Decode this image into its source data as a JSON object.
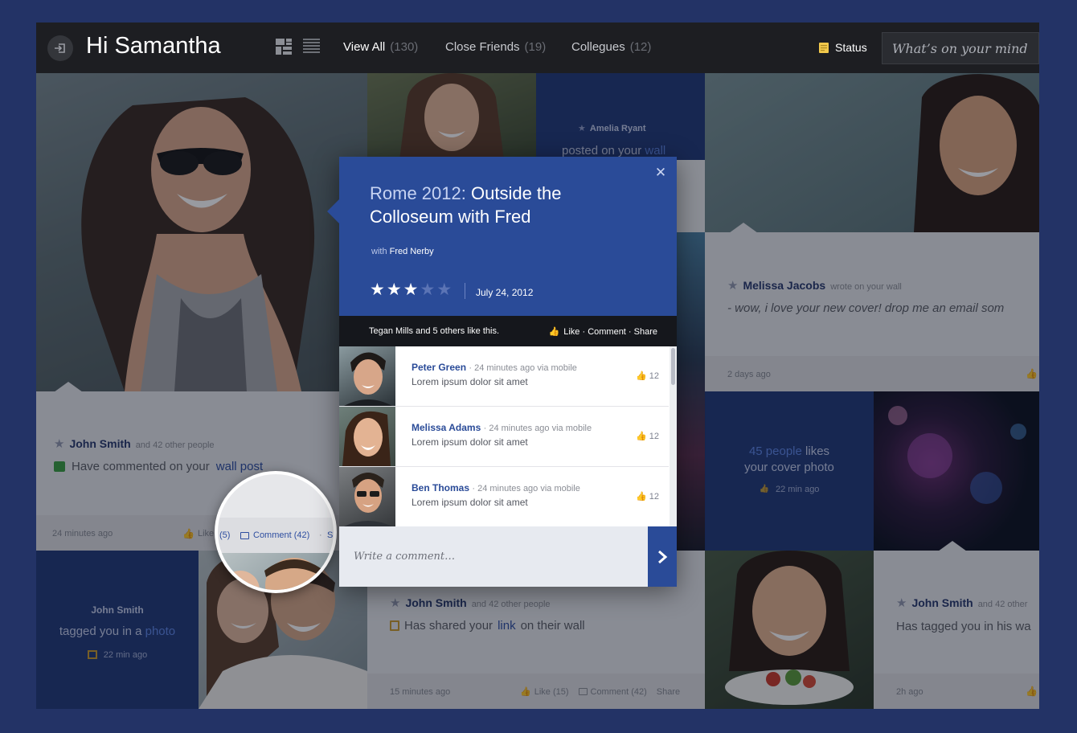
{
  "topbar": {
    "greeting": "Hi Samantha",
    "nav": [
      {
        "label": "View All",
        "count": "(130)"
      },
      {
        "label": "Close Friends",
        "count": "(19)"
      },
      {
        "label": "Collegues",
        "count": "(12)"
      }
    ],
    "status_label": "Status",
    "status_placeholder": "What’s on your mind…"
  },
  "feed": {
    "amelia": {
      "name": "Amelia Ryant",
      "action": "posted on your",
      "link": "wall"
    },
    "melissa_post": {
      "name": "Melissa Jacobs",
      "meta": "wrote on your wall",
      "message": "- wow, i love your new cover! drop me an email som",
      "time": "2 days ago"
    },
    "john_wall": {
      "name": "John Smith",
      "meta": "and 42 other people",
      "message_pre": "Have commented on your",
      "message_link": "wall post",
      "time": "24 minutes ago",
      "like": "Like"
    },
    "cover_likes": {
      "count_text": "45 people",
      "text_a": "likes",
      "text_b": "your cover photo",
      "time": "22 min ago"
    },
    "john_tagged": {
      "name": "John Smith",
      "pre": "tagged you in a",
      "link": "photo",
      "time": "22 min ago"
    },
    "john_link": {
      "name": "John Smith",
      "meta": "and 42 other people",
      "message_pre": "Has shared your",
      "message_link": "link",
      "message_post": "on their wall",
      "time": "15 minutes ago",
      "like": "Like (15)",
      "comment": "Comment (42)",
      "share": "Share"
    },
    "john_right": {
      "name": "John Smith",
      "meta": "and 42 other",
      "message": "Has tagged you in his wa",
      "time": "2h ago"
    }
  },
  "magnifier": {
    "left": "(5)",
    "comment": "Comment (42)",
    "sep": "·",
    "right": "Sh"
  },
  "popup": {
    "title_a": "Rome 2012:",
    "title_b": "Outside the Colloseum with Fred",
    "with_label": "with",
    "with_name": "Fred Nerby",
    "rating": 3,
    "rating_max": 5,
    "date": "July 24, 2012",
    "likes_text": "Tegan Mills and 5 others like this.",
    "actions": "Like · Comment · Share",
    "comments": [
      {
        "name": "Peter Green",
        "meta": "· 24 minutes ago via mobile",
        "text": "Lorem ipsum dolor sit amet",
        "likes": "12"
      },
      {
        "name": "Melissa Adams",
        "meta": "· 24 minutes ago via mobile",
        "text": "Lorem ipsum dolor sit amet",
        "likes": "12"
      },
      {
        "name": "Ben Thomas",
        "meta": "· 24 minutes ago via mobile",
        "text": "Lorem ipsum dolor sit amet",
        "likes": "12"
      }
    ],
    "comment_placeholder": "Write a comment…"
  },
  "colors": {
    "accent": "#2a4b98",
    "bg": "#233366",
    "topbar": "#1d1e22",
    "tile_blue": "#223a77"
  }
}
